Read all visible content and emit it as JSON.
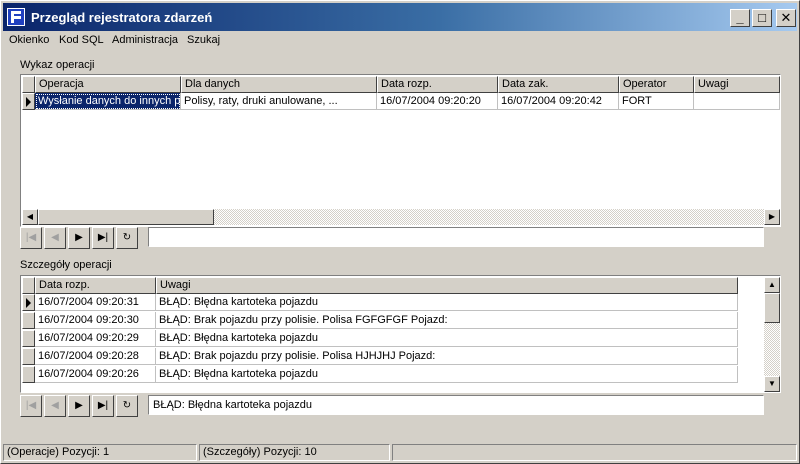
{
  "window": {
    "title": "Przegląd rejestratora zdarzeń"
  },
  "titlebar_buttons": {
    "minimize": "_",
    "maximize": "□",
    "close": "✕"
  },
  "menu": [
    "Okienko",
    "Kod SQL",
    "Administracja",
    "Szukaj"
  ],
  "operations": {
    "label": "Wykaz operacji",
    "columns": [
      "Operacja",
      "Dla danych",
      "Data rozp.",
      "Data zak.",
      "Operator",
      "Uwagi"
    ],
    "rows": [
      [
        "Wysłanie danych do innych pu",
        "Polisy, raty, druki anulowane, ...",
        "16/07/2004 09:20:20",
        "16/07/2004 09:20:42",
        "FORT",
        ""
      ]
    ],
    "memo": ""
  },
  "details": {
    "label": "Szczegóły operacji",
    "columns": [
      "Data rozp.",
      "Uwagi"
    ],
    "rows": [
      [
        "16/07/2004 09:20:31",
        "BŁĄD: Błędna kartoteka pojazdu"
      ],
      [
        "16/07/2004 09:20:30",
        "BŁĄD: Brak pojazdu przy polisie. Polisa FGFGFGF Pojazd:"
      ],
      [
        "16/07/2004 09:20:29",
        "BŁĄD: Błędna kartoteka pojazdu"
      ],
      [
        "16/07/2004 09:20:28",
        "BŁĄD: Brak pojazdu przy polisie. Polisa HJHJHJ Pojazd:"
      ],
      [
        "16/07/2004 09:20:26",
        "BŁĄD: Błędna kartoteka pojazdu"
      ]
    ],
    "memo": "BŁĄD: Błędna kartoteka pojazdu"
  },
  "navigator": {
    "first": "|◀",
    "prior": "◀",
    "next": "▶",
    "last": "▶|",
    "refresh": "↻"
  },
  "status": {
    "ops": "(Operacje)  Pozycji: 1",
    "details": "(Szczegóły)  Pozycji: 10"
  },
  "colors": {
    "selection": "#0a246a",
    "title_start": "#0a246a",
    "title_end": "#a6caf0",
    "face": "#d4d0c8"
  }
}
